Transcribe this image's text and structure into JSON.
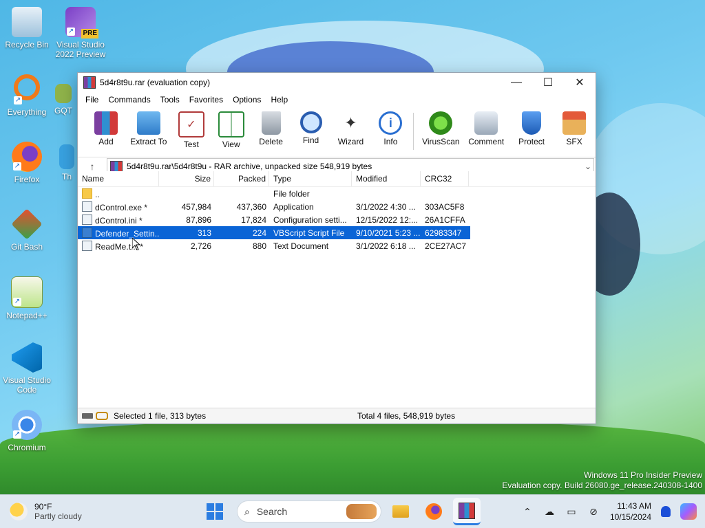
{
  "desktop": {
    "icons": [
      {
        "label": "Recycle Bin"
      },
      {
        "label": "Visual Studio 2022 Preview",
        "badge": "PRE"
      },
      {
        "label": "Everything"
      },
      {
        "label": "GQT"
      },
      {
        "label": "Firefox"
      },
      {
        "label": "Th"
      },
      {
        "label": "Git Bash"
      },
      {
        "label": "Notepad++"
      },
      {
        "label": "Visual Studio Code"
      },
      {
        "label": "Chromium"
      }
    ],
    "watermark_line1": "Windows 11 Pro Insider Preview",
    "watermark_line2": "Evaluation copy. Build 26080.ge_release.240308-1400"
  },
  "window": {
    "title": "5d4r8t9u.rar (evaluation copy)",
    "menu": [
      "File",
      "Commands",
      "Tools",
      "Favorites",
      "Options",
      "Help"
    ],
    "toolbar": [
      {
        "label": "Add",
        "icon": "add-books-icon"
      },
      {
        "label": "Extract To",
        "icon": "folder-extract-icon"
      },
      {
        "label": "Test",
        "icon": "test-clipboard-icon"
      },
      {
        "label": "View",
        "icon": "book-icon"
      },
      {
        "label": "Delete",
        "icon": "trash-icon"
      },
      {
        "label": "Find",
        "icon": "magnifier-icon"
      },
      {
        "label": "Wizard",
        "icon": "wand-icon"
      },
      {
        "label": "Info",
        "icon": "info-icon"
      },
      {
        "label": "VirusScan",
        "icon": "virus-icon"
      },
      {
        "label": "Comment",
        "icon": "comment-icon"
      },
      {
        "label": "Protect",
        "icon": "shield-icon"
      },
      {
        "label": "SFX",
        "icon": "sfx-box-icon"
      }
    ],
    "address": "5d4r8t9u.rar\\5d4r8t9u - RAR archive, unpacked size 548,919 bytes",
    "columns": {
      "name": "Name",
      "size": "Size",
      "packed": "Packed",
      "type": "Type",
      "modified": "Modified",
      "crc": "CRC32"
    },
    "files": [
      {
        "name": "..",
        "size": "",
        "packed": "",
        "type": "File folder",
        "modified": "",
        "crc": "",
        "icon": "folder"
      },
      {
        "name": "dControl.exe *",
        "size": "457,984",
        "packed": "437,360",
        "type": "Application",
        "modified": "3/1/2022 4:30 ...",
        "crc": "303AC5F8",
        "icon": "exe"
      },
      {
        "name": "dControl.ini *",
        "size": "87,896",
        "packed": "17,824",
        "type": "Configuration setti...",
        "modified": "12/15/2022 12:...",
        "crc": "26A1CFFA",
        "icon": "ini"
      },
      {
        "name": "Defender_Settin...",
        "size": "313",
        "packed": "224",
        "type": "VBScript Script File",
        "modified": "9/10/2021 5:23 ...",
        "crc": "62983347",
        "icon": "vbs",
        "selected": true
      },
      {
        "name": "ReadMe.t... *",
        "size": "2,726",
        "packed": "880",
        "type": "Text Document",
        "modified": "3/1/2022 6:18 ...",
        "crc": "2CE27AC7",
        "icon": "txt"
      }
    ],
    "status_left": "Selected 1 file, 313 bytes",
    "status_right": "Total 4 files, 548,919 bytes"
  },
  "taskbar": {
    "weather_temp": "90°F",
    "weather_desc": "Partly cloudy",
    "search_placeholder": "Search",
    "time": "11:43 AM",
    "date": "10/15/2024"
  }
}
